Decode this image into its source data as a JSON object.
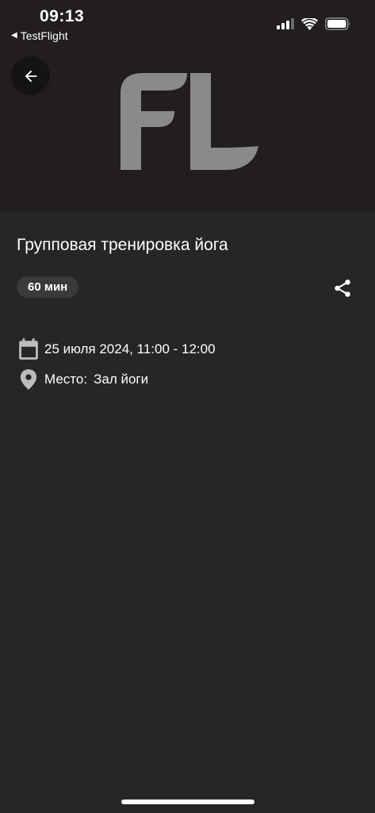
{
  "status_bar": {
    "time": "09:13",
    "back_app": "TestFlight"
  },
  "header": {
    "back_icon": "arrow-left-icon",
    "logo": "FL"
  },
  "event": {
    "title": "Групповая тренировка йога",
    "duration": "60 мин",
    "date_time": "25 июля 2024, 11:00 - 12:00",
    "place_label": "Место:",
    "place_value": "Зал йоги"
  },
  "icons": {
    "calendar": "calendar-icon",
    "location": "location-pin-icon",
    "share": "share-icon"
  },
  "colors": {
    "hero_bg": "#211d21",
    "content_bg": "#262626",
    "chip_bg": "#3a3a3a",
    "logo_fill": "#8a8a8a",
    "icon_gray": "#bdbdbd"
  }
}
